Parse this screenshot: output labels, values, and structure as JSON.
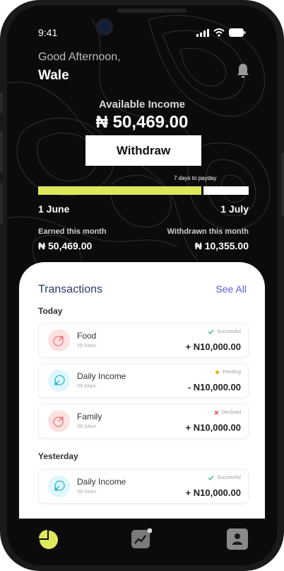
{
  "status_bar": {
    "time": "9:41"
  },
  "greeting": "Good Afternoon,",
  "user_name": "Wale",
  "balance": {
    "label": "Available Income",
    "amount": "₦ 50,469.00"
  },
  "withdraw_label": "Withdraw",
  "payday": {
    "text": "7 days to payday",
    "progress": 0.78,
    "start": "1 June",
    "end": "1 July"
  },
  "stats": {
    "earned_label": "Earned this month",
    "earned_value": "₦ 50,469.00",
    "withdrawn_label": "Withdrawn this month",
    "withdrawn_value": "₦ 10,355.00"
  },
  "transactions": {
    "title": "Transactions",
    "see_all": "See All",
    "groups": [
      {
        "label": "Today",
        "items": [
          {
            "title": "Food",
            "time": "09:34am",
            "status": "Successful",
            "amount": "+ N10,000.00",
            "icon": "outgoing-arrow-icon"
          },
          {
            "title": "Daily Income",
            "time": "09:34am",
            "status": "Pending",
            "amount": "- N10,000.00",
            "icon": "incoming-arrow-icon"
          },
          {
            "title": "Family",
            "time": "09:34am",
            "status": "Declined",
            "amount": "+ N10,000.00",
            "icon": "outgoing-arrow-icon"
          }
        ]
      },
      {
        "label": "Yesterday",
        "items": [
          {
            "title": "Daily Income",
            "time": "09:34am",
            "status": "Successful",
            "amount": "+ N10,000.00",
            "icon": "incoming-arrow-icon"
          }
        ]
      }
    ]
  },
  "colors": {
    "accent": "#dfe85c",
    "link": "#5b5bd6",
    "success": "#3fb98a",
    "pending": "#f5b400",
    "declined": "#e2453c"
  },
  "tabs": [
    "home-pie-icon",
    "stats-chart-icon",
    "profile-icon"
  ]
}
